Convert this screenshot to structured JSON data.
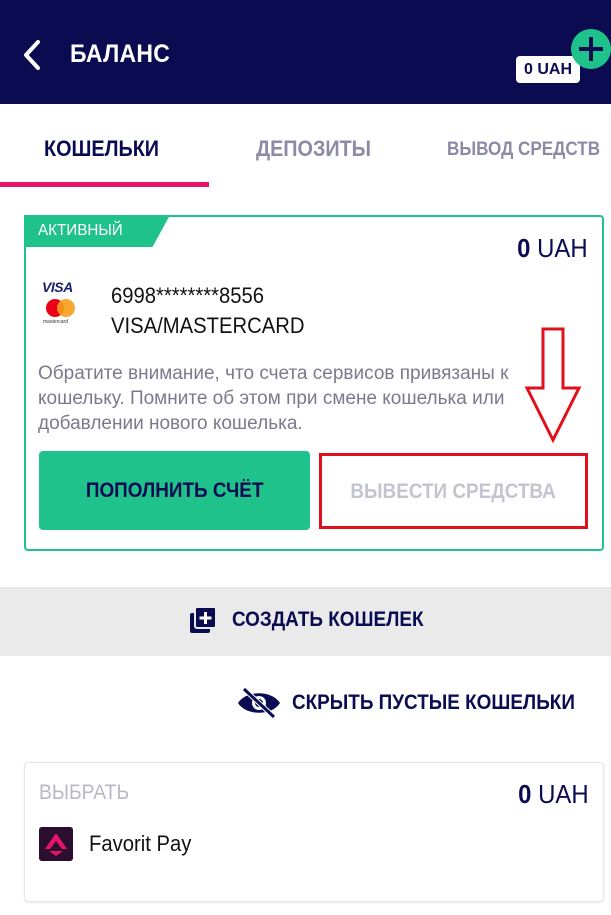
{
  "header": {
    "title": "БАЛАНС",
    "balance": "0 UAH"
  },
  "tabs": [
    {
      "label": "КОШЕЛЬКИ",
      "active": true
    },
    {
      "label": "ДЕПОЗИТЫ",
      "active": false
    },
    {
      "label": "ВЫВОД СРЕДСТВ",
      "active": false
    }
  ],
  "wallet": {
    "status": "АКТИВНЫЙ",
    "amount": "0",
    "currency": "UAH",
    "card_brand_text": "VISA",
    "mastercard_text": "mastercard",
    "card_number": "6998********8556",
    "card_type": "VISA/MASTERCARD",
    "notice": "Обратите внимание, что счета сервисов привязаны к кошельку. Помните об этом при смене кошелька или добавлении нового кошелька.",
    "deposit_button": "ПОПОЛНИТЬ СЧЁТ",
    "withdraw_button": "ВЫВЕСТИ СРЕДСТВА"
  },
  "create_wallet": {
    "label": "СОЗДАТЬ КОШЕЛЕК",
    "icon": "add-box-icon"
  },
  "hide_empty": {
    "label": "СКРЫТЬ ПУСТЫЕ КОШЕЛЬКИ",
    "icon": "eye-off-icon"
  },
  "wallet2": {
    "choose_label": "ВЫБРАТЬ",
    "amount": "0",
    "currency": "UAH",
    "name": "Favorit Pay"
  },
  "colors": {
    "header_bg": "#0b0b52",
    "accent_green": "#1fc28a",
    "tab_underline": "#e9126b",
    "annotation_red": "#e0101c"
  }
}
